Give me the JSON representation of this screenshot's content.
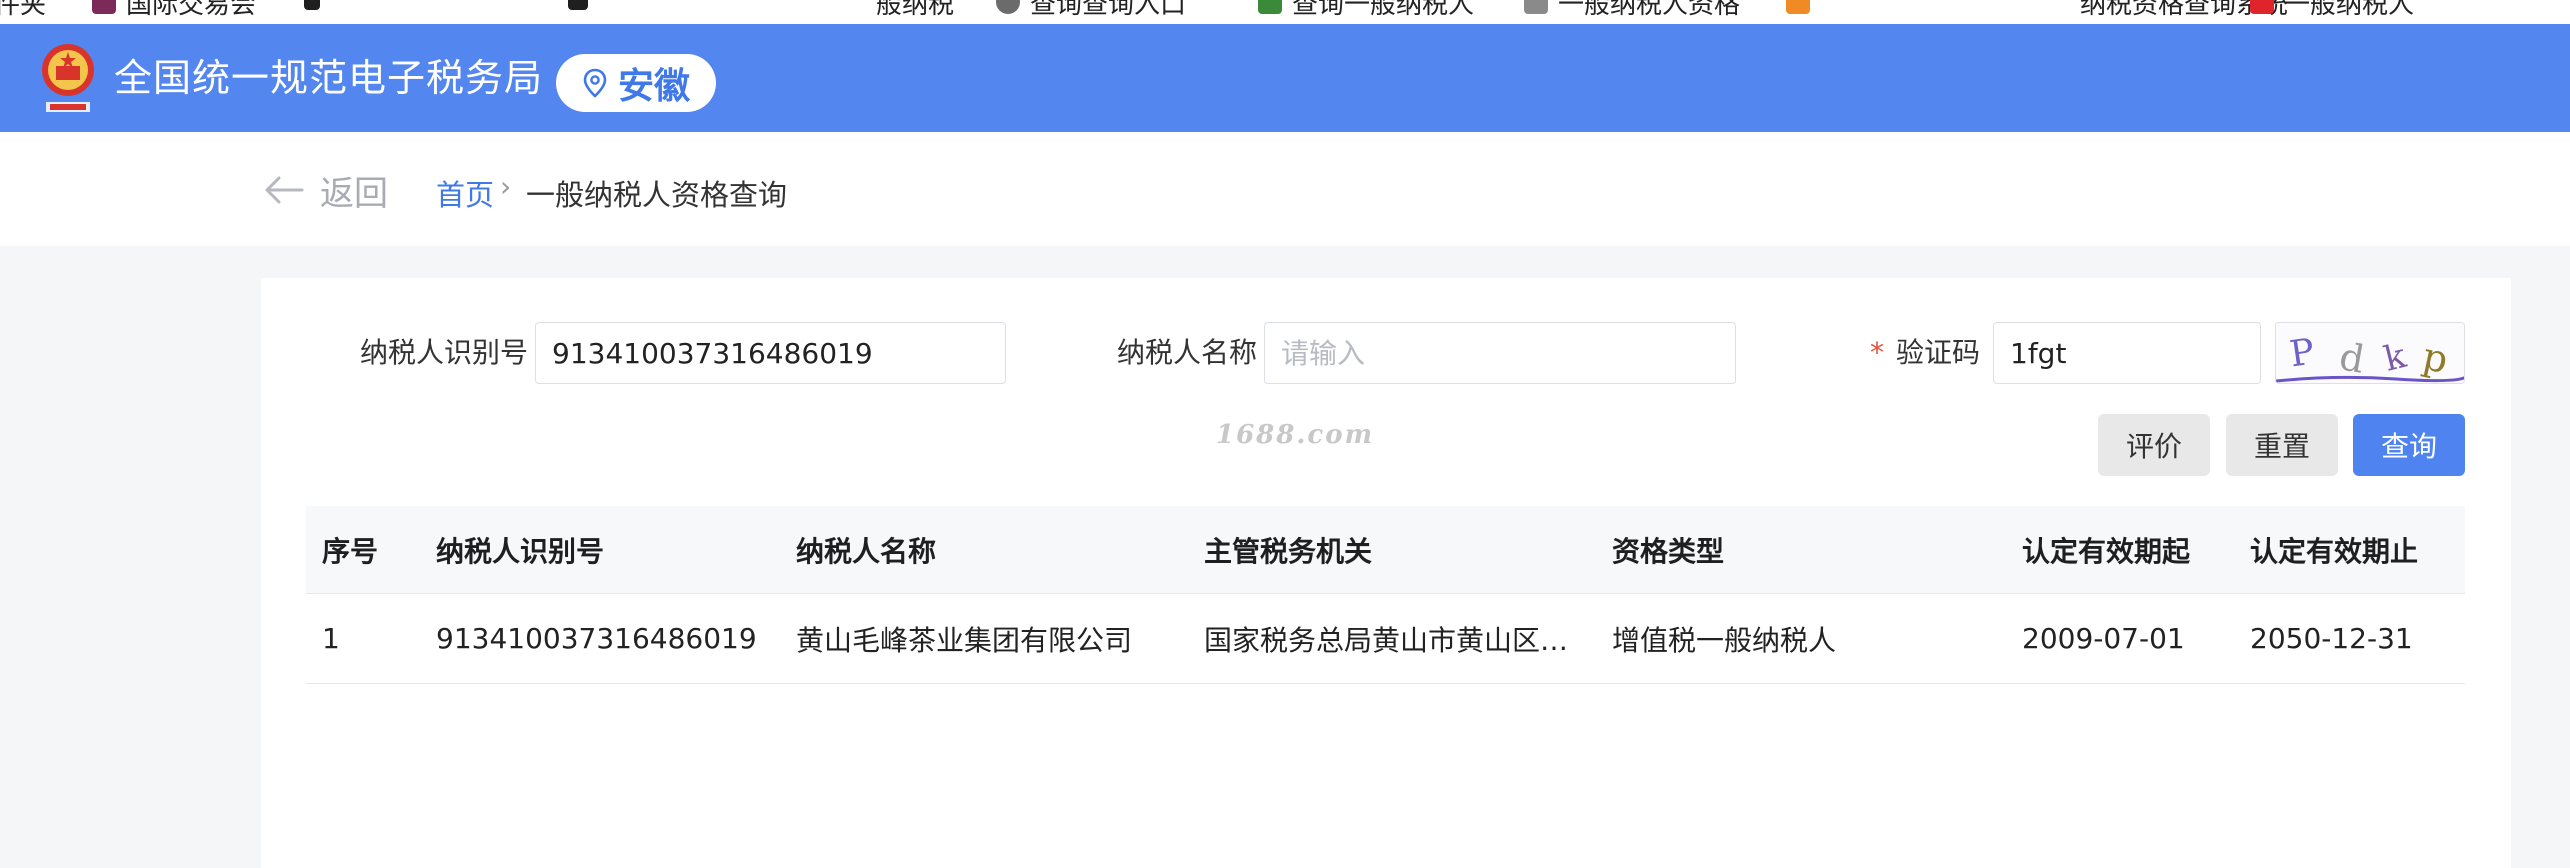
{
  "bookmarks": [
    {
      "label": "",
      "icon_color": "#ffffff"
    },
    {
      "label": "国际交易会",
      "icon_color": "#7b2a5a"
    },
    {
      "label": "",
      "icon_color": "#1f1f1f"
    },
    {
      "label": "",
      "icon_color": "#1f1f1f"
    },
    {
      "label": "",
      "icon_color": "#c0c0c0"
    },
    {
      "label": "般纳税",
      "icon_color": "#ffffff"
    },
    {
      "label": "查询查询入口",
      "icon_color": "#6b6b6b"
    },
    {
      "label": "查询一般纳税人",
      "icon_color": "#3a8a3a"
    },
    {
      "label": "一般纳税人资格",
      "icon_color": "#8a8a8a"
    },
    {
      "label": "",
      "icon_color": "#f08a24"
    },
    {
      "label": "纳税资格查询系统",
      "icon_color": "#ffffff"
    },
    {
      "label": "一般纳税人",
      "icon_color": "#e0242c"
    }
  ],
  "header": {
    "title": "全国统一规范电子税务局",
    "region": "安徽",
    "bg_color": "#5386ee"
  },
  "breadcrumb": {
    "back": "返回",
    "home": "首页",
    "separator": "›",
    "current": "一般纳税人资格查询"
  },
  "form": {
    "taxpayer_id": {
      "label": "纳税人识别号",
      "value": "913410037316486019"
    },
    "taxpayer_name": {
      "label": "纳税人名称",
      "placeholder": "请输入",
      "value": ""
    },
    "captcha": {
      "required_mark": "*",
      "label": "验证码",
      "value": "1fgt",
      "image_chars": [
        "P",
        "d",
        "k",
        "p"
      ]
    }
  },
  "watermark": "1688.com",
  "buttons": {
    "evaluate": "评价",
    "reset": "重置",
    "query": "查询",
    "primary_color": "#4f83ef"
  },
  "table": {
    "columns": [
      "序号",
      "纳税人识别号",
      "纳税人名称",
      "主管税务机关",
      "资格类型",
      "认定有效期起",
      "认定有效期止"
    ],
    "rows": [
      [
        "1",
        "913410037316486019",
        "黄山毛峰茶业集团有限公司",
        "国家税务总局黄山市黄山区税务局",
        "增值税一般纳税人",
        "2009-07-01",
        "2050-12-31"
      ]
    ]
  }
}
